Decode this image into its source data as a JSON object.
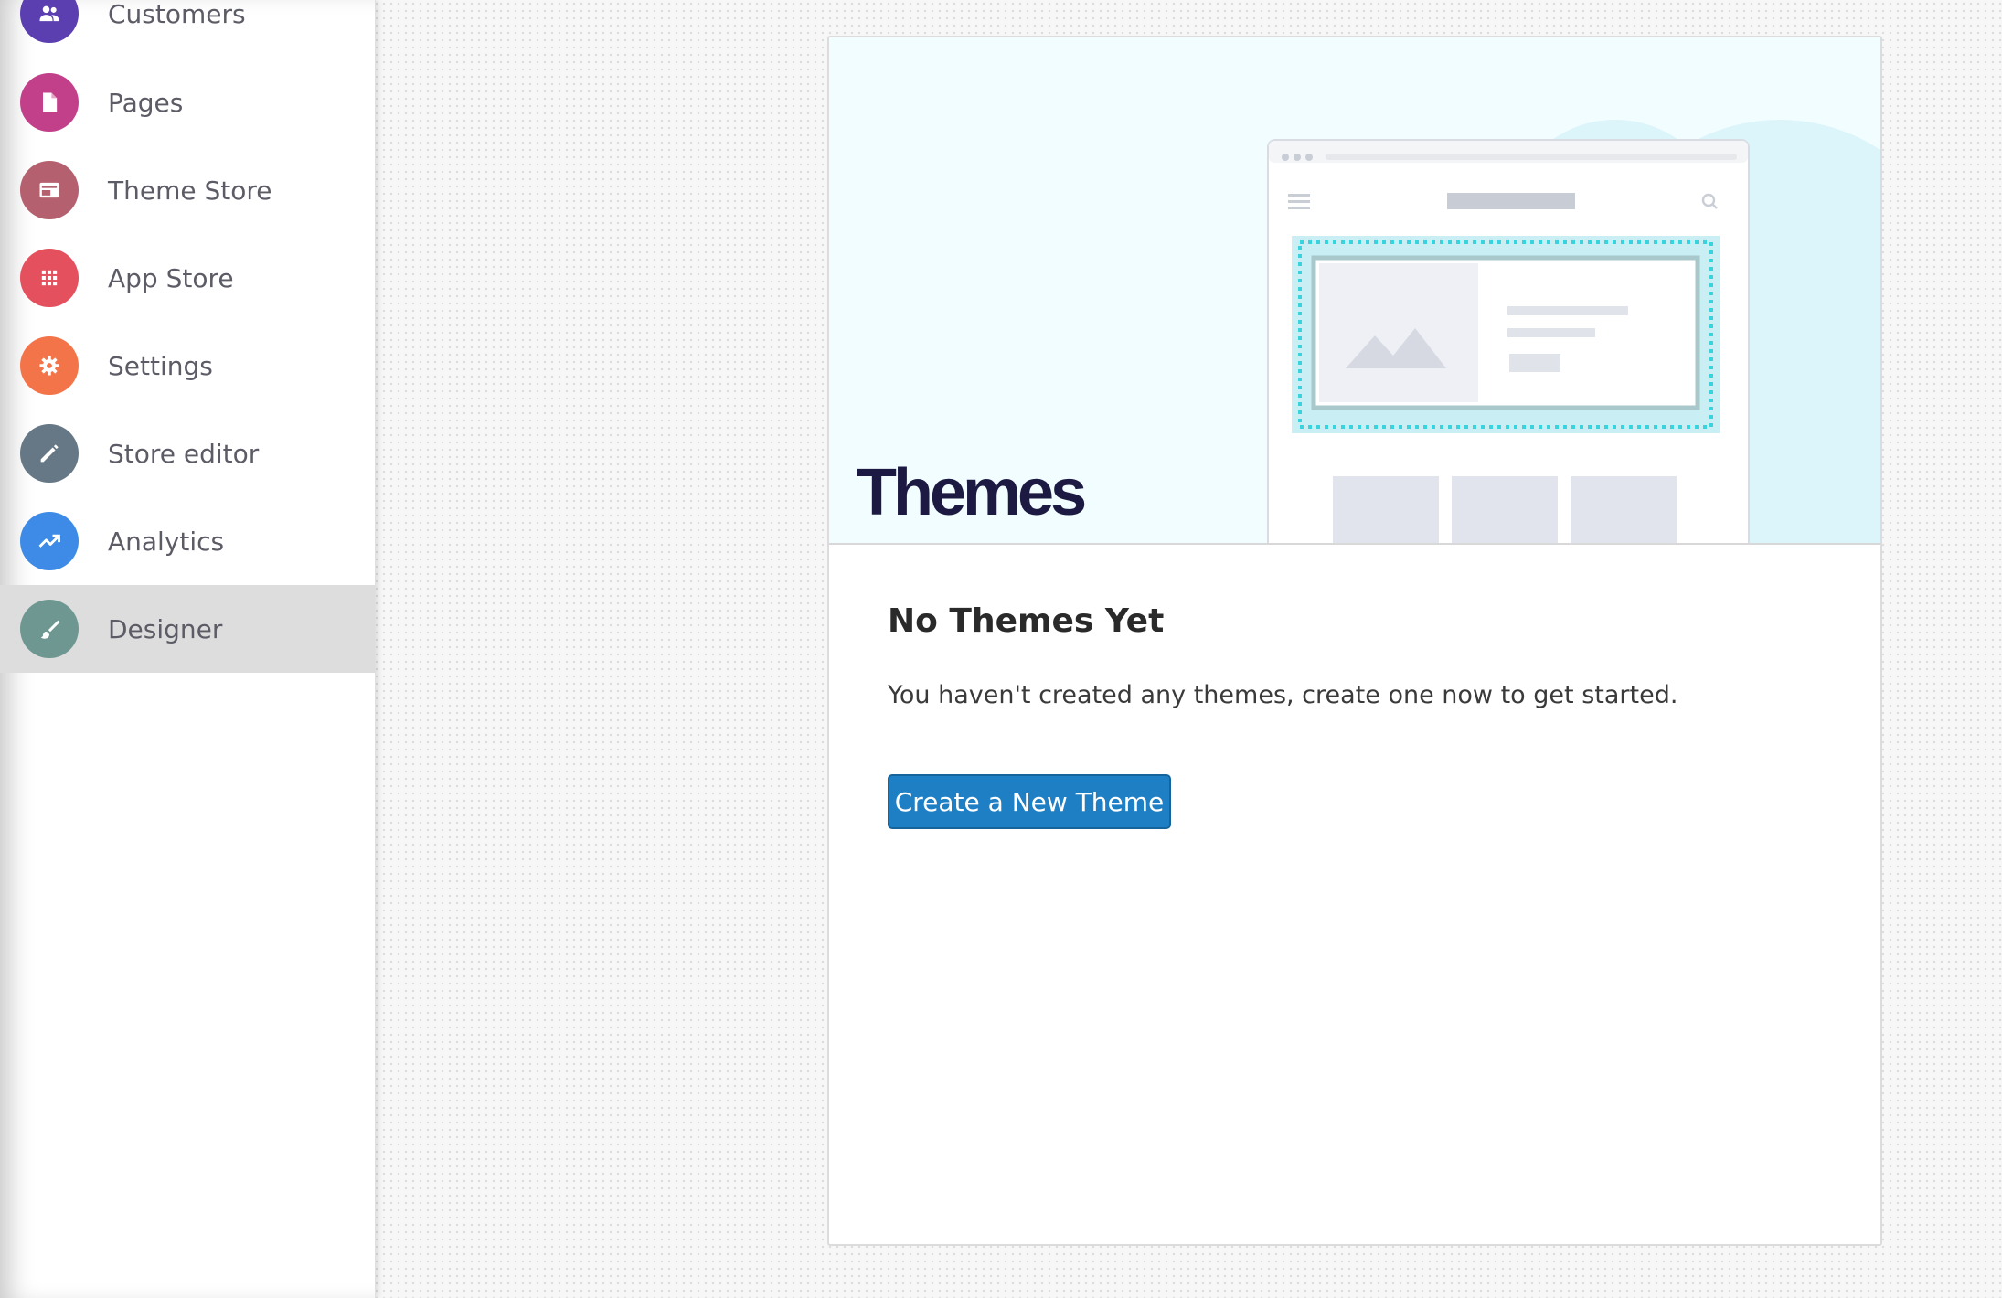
{
  "sidebar": {
    "items": [
      {
        "label": "Customers",
        "icon": "users-icon",
        "color": "#5b3fb0"
      },
      {
        "label": "Pages",
        "icon": "document-icon",
        "color": "#c2408a"
      },
      {
        "label": "Theme Store",
        "icon": "theme-store-icon",
        "color": "#b4606f"
      },
      {
        "label": "App Store",
        "icon": "apps-grid-icon",
        "color": "#e4505d"
      },
      {
        "label": "Settings",
        "icon": "gear-icon",
        "color": "#f4744a"
      },
      {
        "label": "Store editor",
        "icon": "pencil-icon",
        "color": "#667885"
      },
      {
        "label": "Analytics",
        "icon": "trending-up-icon",
        "color": "#3d8be6"
      },
      {
        "label": "Designer",
        "icon": "brush-icon",
        "color": "#6f9792",
        "active": true
      }
    ]
  },
  "main": {
    "hero_title": "Themes",
    "heading": "No Themes Yet",
    "description": "You haven't created any themes, create one now to get started.",
    "create_button_label": "Create a New Theme"
  },
  "colors": {
    "accent": "#1f7fc4",
    "hero_bg": "#f2fdff",
    "highlight_dots": "#38d3dc"
  }
}
